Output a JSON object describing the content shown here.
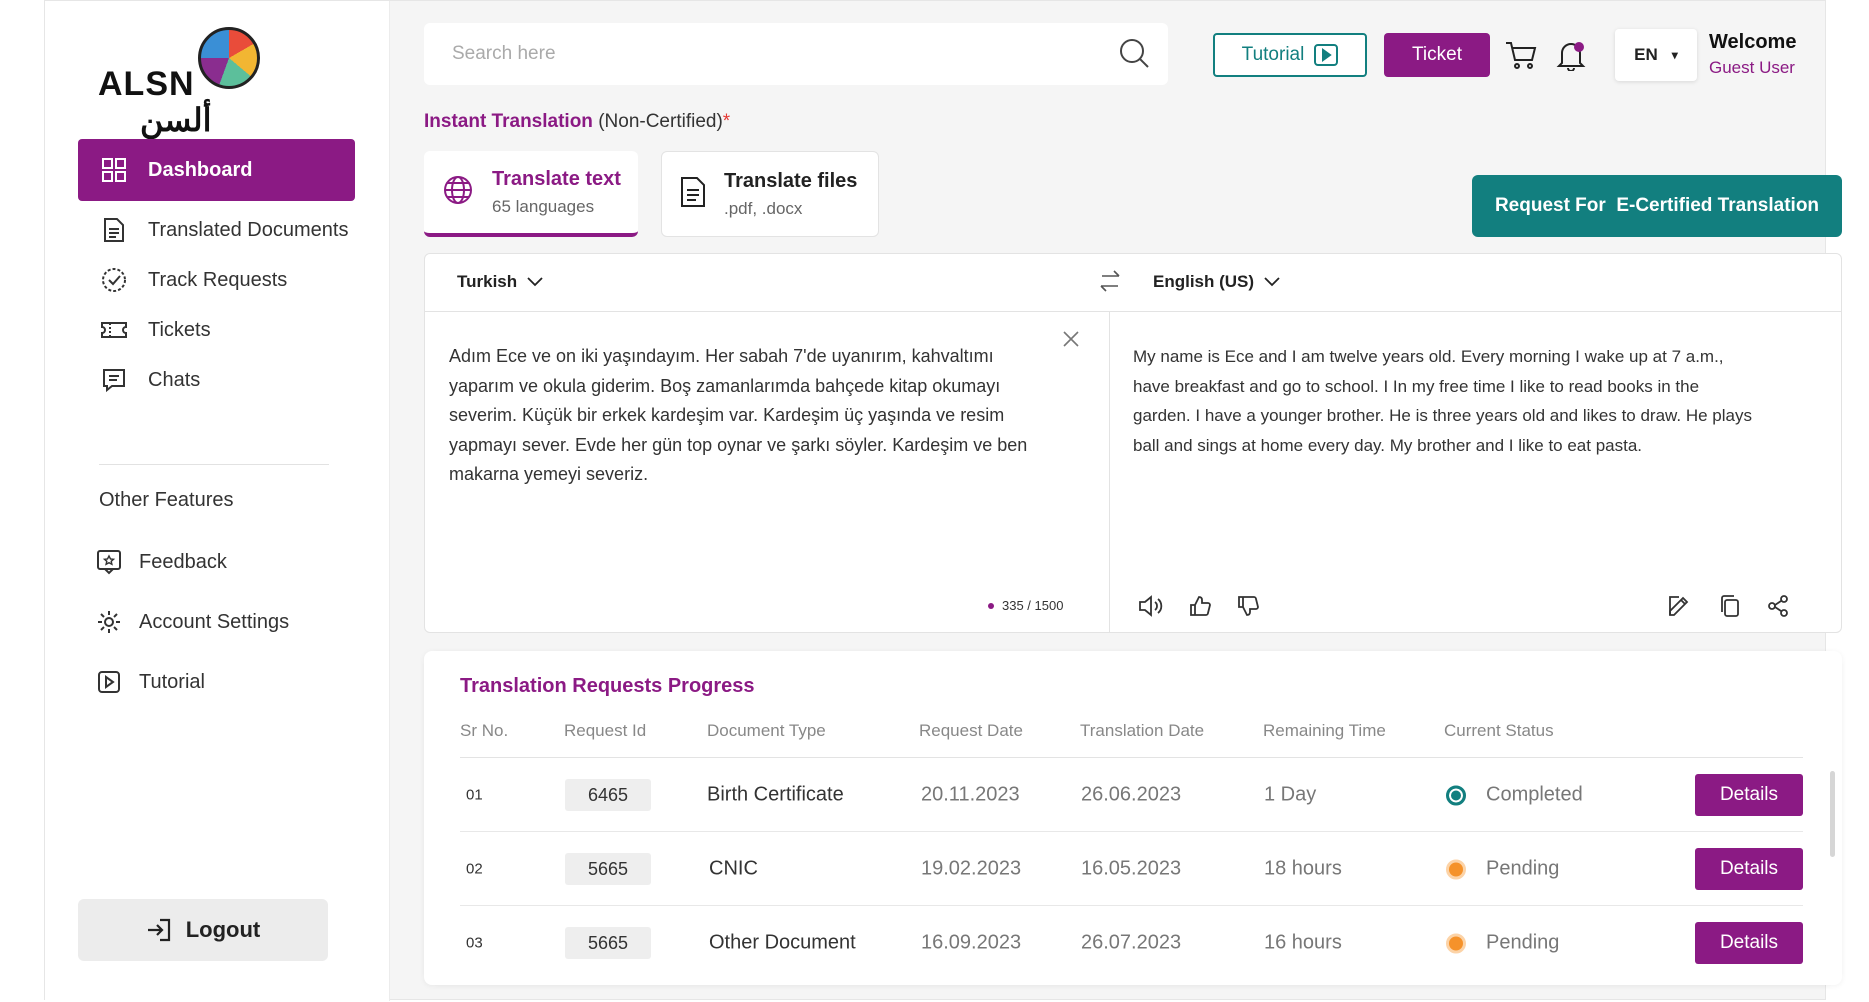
{
  "logo": {
    "latin": "ALSN",
    "arabic": "ألسن"
  },
  "sidebar": {
    "items": [
      {
        "label": "Dashboard",
        "icon": "dashboard-grid-icon",
        "active": true
      },
      {
        "label": "Translated Documents",
        "icon": "document-icon"
      },
      {
        "label": "Track Requests",
        "icon": "check-circle-icon"
      },
      {
        "label": "Tickets",
        "icon": "ticket-icon"
      },
      {
        "label": "Chats",
        "icon": "chat-icon"
      }
    ],
    "section_title": "Other Features",
    "other": [
      {
        "label": "Feedback",
        "icon": "feedback-icon"
      },
      {
        "label": "Account Settings",
        "icon": "gear-icon"
      },
      {
        "label": "Tutorial",
        "icon": "play-icon"
      }
    ],
    "logout_label": "Logout"
  },
  "header": {
    "search_placeholder": "Search here",
    "tutorial_label": "Tutorial",
    "ticket_label": "Ticket",
    "language": "EN",
    "welcome": "Welcome",
    "user": "Guest User"
  },
  "translation": {
    "heading_main": "Instant Translation",
    "heading_sub": " (Non-Certified)",
    "heading_required": "*",
    "tabs": [
      {
        "title": "Translate text",
        "subtitle": "65 languages"
      },
      {
        "title": "Translate files",
        "subtitle": ".pdf, .docx"
      }
    ],
    "ecert_button": "Request For  E-Certified Translation",
    "source_language": "Turkish",
    "target_language": "English (US)",
    "source_text": "Adım Ece ve on iki yaşındayım. Her sabah 7'de uyanırım, kahvaltımı yaparım ve okula giderim. Boş zamanlarımda bahçede kitap okumayı severim. Küçük bir erkek kardeşim var. Kardeşim üç yaşında ve resim yapmayı sever. Evde her gün top oynar ve şarkı söyler. Kardeşim ve ben makarna yemeyi severiz.",
    "target_text": "My name is Ece and I am twelve years old. Every morning I wake up at 7 a.m., have breakfast and go to school. I In my free time I like to read books in the garden. I have a younger brother. He is three years old and likes to draw. He plays ball and sings at home every day. My brother and I like to eat pasta.",
    "char_count": "335 / 1500"
  },
  "progress": {
    "title": "Translation Requests Progress",
    "columns": [
      "Sr No.",
      "Request Id",
      "Document Type",
      "Request Date",
      "Translation Date",
      "Remaining Time",
      "Current Status"
    ],
    "rows": [
      {
        "sr": "01",
        "id": "6465",
        "doc": "Birth Certificate",
        "req_date": "20.11.2023",
        "tr_date": "26.06.2023",
        "remaining": "1 Day",
        "status": "Completed",
        "status_color": "#127f7f",
        "action": "Details"
      },
      {
        "sr": "02",
        "id": "5665",
        "doc": "CNIC",
        "req_date": "19.02.2023",
        "tr_date": "16.05.2023",
        "remaining": "18 hours",
        "status": "Pending",
        "status_color": "#f5922a",
        "action": "Details"
      },
      {
        "sr": "03",
        "id": "5665",
        "doc": "Other Document",
        "req_date": "16.09.2023",
        "tr_date": "26.07.2023",
        "remaining": "16 hours",
        "status": "Pending",
        "status_color": "#f5922a",
        "action": "Details"
      }
    ]
  },
  "colors": {
    "primary": "#8b1a84",
    "teal": "#127f7f",
    "pending": "#f5922a"
  }
}
